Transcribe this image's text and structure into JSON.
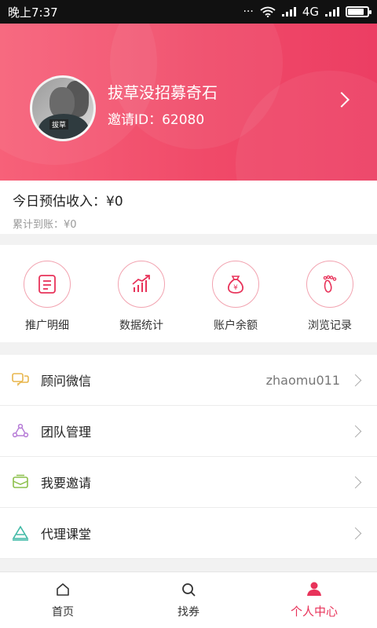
{
  "status_bar": {
    "time": "晚上7:37",
    "network": "4G",
    "battery_level": 0.85
  },
  "profile": {
    "username": "拔草没招募奇石",
    "invite_label": "邀请ID：",
    "invite_id": "62080",
    "avatar_tag": "拔草"
  },
  "income": {
    "today_label": "今日预估收入：",
    "today_value": "¥0",
    "total_label": "累计到账：",
    "total_value": "¥0"
  },
  "quick_actions": [
    {
      "label": "推广明细",
      "icon": "document-list-icon"
    },
    {
      "label": "数据统计",
      "icon": "chart-trend-icon"
    },
    {
      "label": "账户余额",
      "icon": "money-bag-icon"
    },
    {
      "label": "浏览记录",
      "icon": "footprint-icon"
    }
  ],
  "menu": [
    {
      "label": "顾问微信",
      "value": "zhaomu011",
      "icon": "chat-icon",
      "color": "#e8b64c"
    },
    {
      "label": "团队管理",
      "value": "",
      "icon": "team-icon",
      "color": "#b57ad6"
    },
    {
      "label": "我要邀请",
      "value": "",
      "icon": "invite-icon",
      "color": "#8cc04b"
    },
    {
      "label": "代理课堂",
      "value": "",
      "icon": "classroom-icon",
      "color": "#3fb9a5"
    }
  ],
  "tabs": [
    {
      "label": "首页",
      "icon": "home-icon",
      "active": false
    },
    {
      "label": "找券",
      "icon": "search-icon",
      "active": false
    },
    {
      "label": "个人中心",
      "icon": "user-icon",
      "active": true
    }
  ],
  "colors": {
    "accent": "#e8335a",
    "header_start": "#f76179",
    "header_end": "#ec3e63"
  }
}
